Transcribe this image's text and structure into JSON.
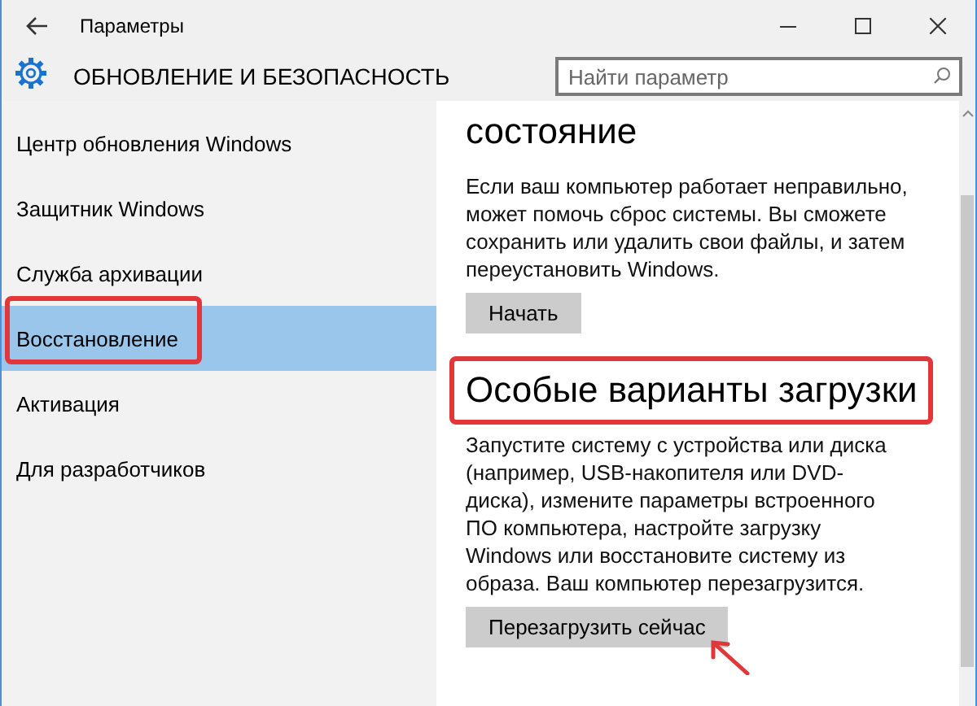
{
  "window": {
    "title": "Параметры"
  },
  "header": {
    "title": "ОБНОВЛЕНИЕ И БЕЗОПАСНОСТЬ"
  },
  "search": {
    "placeholder": "Найти параметр"
  },
  "sidebar": {
    "items": [
      {
        "label": "Центр обновления Windows",
        "selected": false,
        "highlighted": false
      },
      {
        "label": "Защитник Windows",
        "selected": false,
        "highlighted": false
      },
      {
        "label": "Служба архивации",
        "selected": false,
        "highlighted": false
      },
      {
        "label": "Восстановление",
        "selected": true,
        "highlighted": true
      },
      {
        "label": "Активация",
        "selected": false,
        "highlighted": false
      },
      {
        "label": "Для разработчиков",
        "selected": false,
        "highlighted": false
      }
    ]
  },
  "sections": [
    {
      "heading": "состояние",
      "heading_highlighted": false,
      "text": "Если ваш компьютер работает неправильно, может помочь сброс системы. Вы сможете сохранить или удалить свои файлы, и затем переустановить Windows.",
      "button": "Начать",
      "button_pointed": false
    },
    {
      "heading": "Особые варианты загрузки",
      "heading_highlighted": true,
      "text": "Запустите систему с устройства или диска (например, USB-накопителя или DVD-диска), измените параметры встроенного ПО компьютера, настройте загрузку Windows или восстановите систему из образа. Ваш компьютер перезагрузится.",
      "button": "Перезагрузить сейчас",
      "button_pointed": true
    }
  ]
}
